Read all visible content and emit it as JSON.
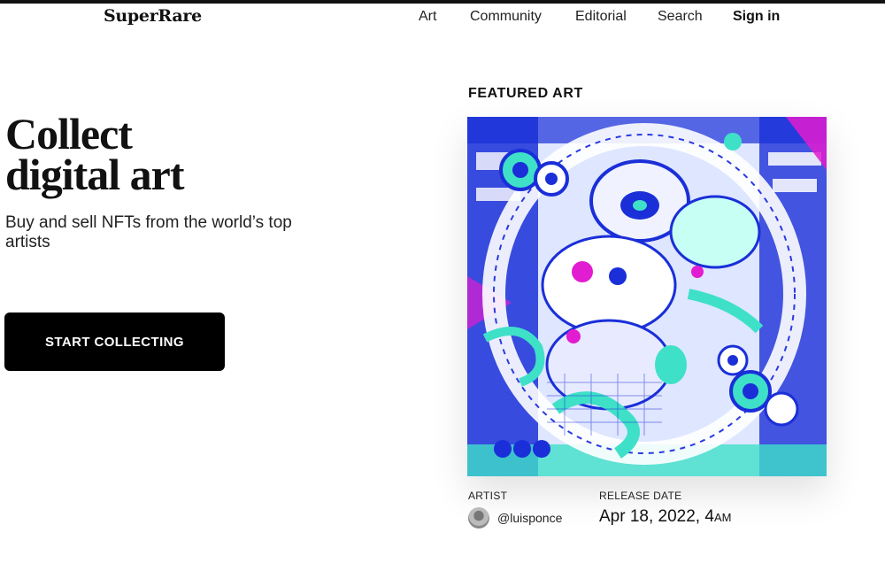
{
  "header": {
    "logo": "SuperRare",
    "nav": {
      "art": "Art",
      "community": "Community",
      "editorial": "Editorial",
      "search": "Search",
      "sign_in": "Sign in"
    }
  },
  "hero": {
    "title_line1": "Collect",
    "title_line2": "digital art",
    "subtitle": "Buy and sell NFTs from the world’s top artists",
    "cta_label": "START COLLECTING"
  },
  "featured": {
    "label": "FEATURED ART",
    "artist_label": "ARTIST",
    "artist_handle": "@luisponce",
    "release_label": "RELEASE DATE",
    "release_date": "Apr 18, 2022, 4",
    "release_ampm": "AM"
  },
  "colors": {
    "accent_black": "#000000",
    "art_blue": "#1a2fd8",
    "art_teal": "#3fe0c8",
    "art_magenta": "#e21cd0"
  }
}
